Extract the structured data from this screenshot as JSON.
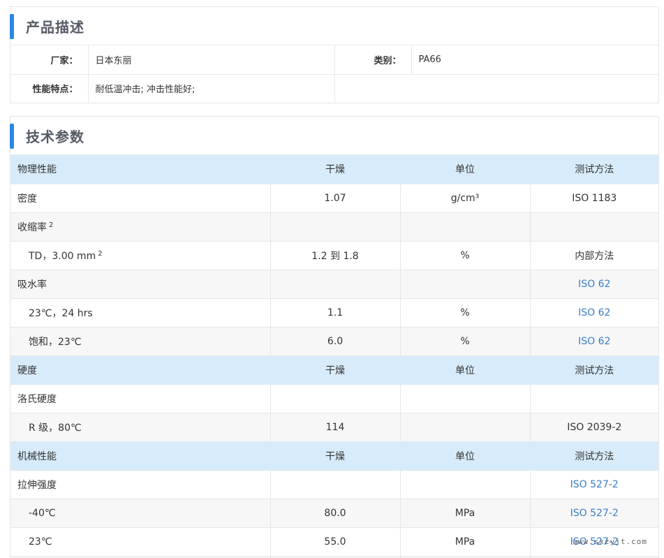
{
  "description": {
    "title": "产品描述",
    "manufacturer_label": "厂家：",
    "manufacturer_value": "日本东丽",
    "category_label": "类别：",
    "category_value": "PA66",
    "features_label": "性能特点：",
    "features_value": "耐低温冲击; 冲击性能好;"
  },
  "tech": {
    "title": "技术参数",
    "rows": [
      {
        "type": "head",
        "cells": [
          "物理性能",
          "干燥",
          "单位",
          "测试方法"
        ]
      },
      {
        "type": "row",
        "cells": [
          "密度",
          "1.07",
          "g/cm³",
          "ISO 1183"
        ]
      },
      {
        "type": "row",
        "alt": true,
        "cells": [
          "收缩率",
          "",
          "",
          ""
        ],
        "sup": "2"
      },
      {
        "type": "row",
        "sub": true,
        "cells": [
          "TD，3.00 mm",
          "1.2 到 1.8",
          "%",
          "内部方法"
        ],
        "sup": "2"
      },
      {
        "type": "row",
        "alt": true,
        "cells": [
          "吸水率",
          "",
          "",
          "ISO 62"
        ],
        "link": true
      },
      {
        "type": "row",
        "sub": true,
        "cells": [
          "23℃，24 hrs",
          "1.1",
          "%",
          "ISO 62"
        ],
        "link": true
      },
      {
        "type": "row",
        "alt": true,
        "sub": true,
        "cells": [
          "饱和，23℃",
          "6.0",
          "%",
          "ISO 62"
        ],
        "link": true
      },
      {
        "type": "head",
        "cells": [
          "硬度",
          "干燥",
          "单位",
          "测试方法"
        ]
      },
      {
        "type": "row",
        "cells": [
          "洛氏硬度",
          "",
          "",
          ""
        ]
      },
      {
        "type": "row",
        "alt": true,
        "sub": true,
        "cells": [
          "R 级，80℃",
          "114",
          "",
          "ISO 2039-2"
        ]
      },
      {
        "type": "head",
        "cells": [
          "机械性能",
          "干燥",
          "单位",
          "测试方法"
        ]
      },
      {
        "type": "row",
        "cells": [
          "拉伸强度",
          "",
          "",
          "ISO 527-2"
        ],
        "link": true
      },
      {
        "type": "row",
        "alt": true,
        "sub": true,
        "cells": [
          "-40℃",
          "80.0",
          "MPa",
          "ISO 527-2"
        ],
        "link": true
      },
      {
        "type": "row",
        "sub": true,
        "cells": [
          "23℃",
          "55.0",
          "MPa",
          "ISO 527-2"
        ],
        "link": true
      },
      {
        "type": "row",
        "alt": true,
        "cells": [
          "",
          "",
          "",
          ""
        ]
      }
    ]
  },
  "watermark": "www.sxzyjt.com"
}
